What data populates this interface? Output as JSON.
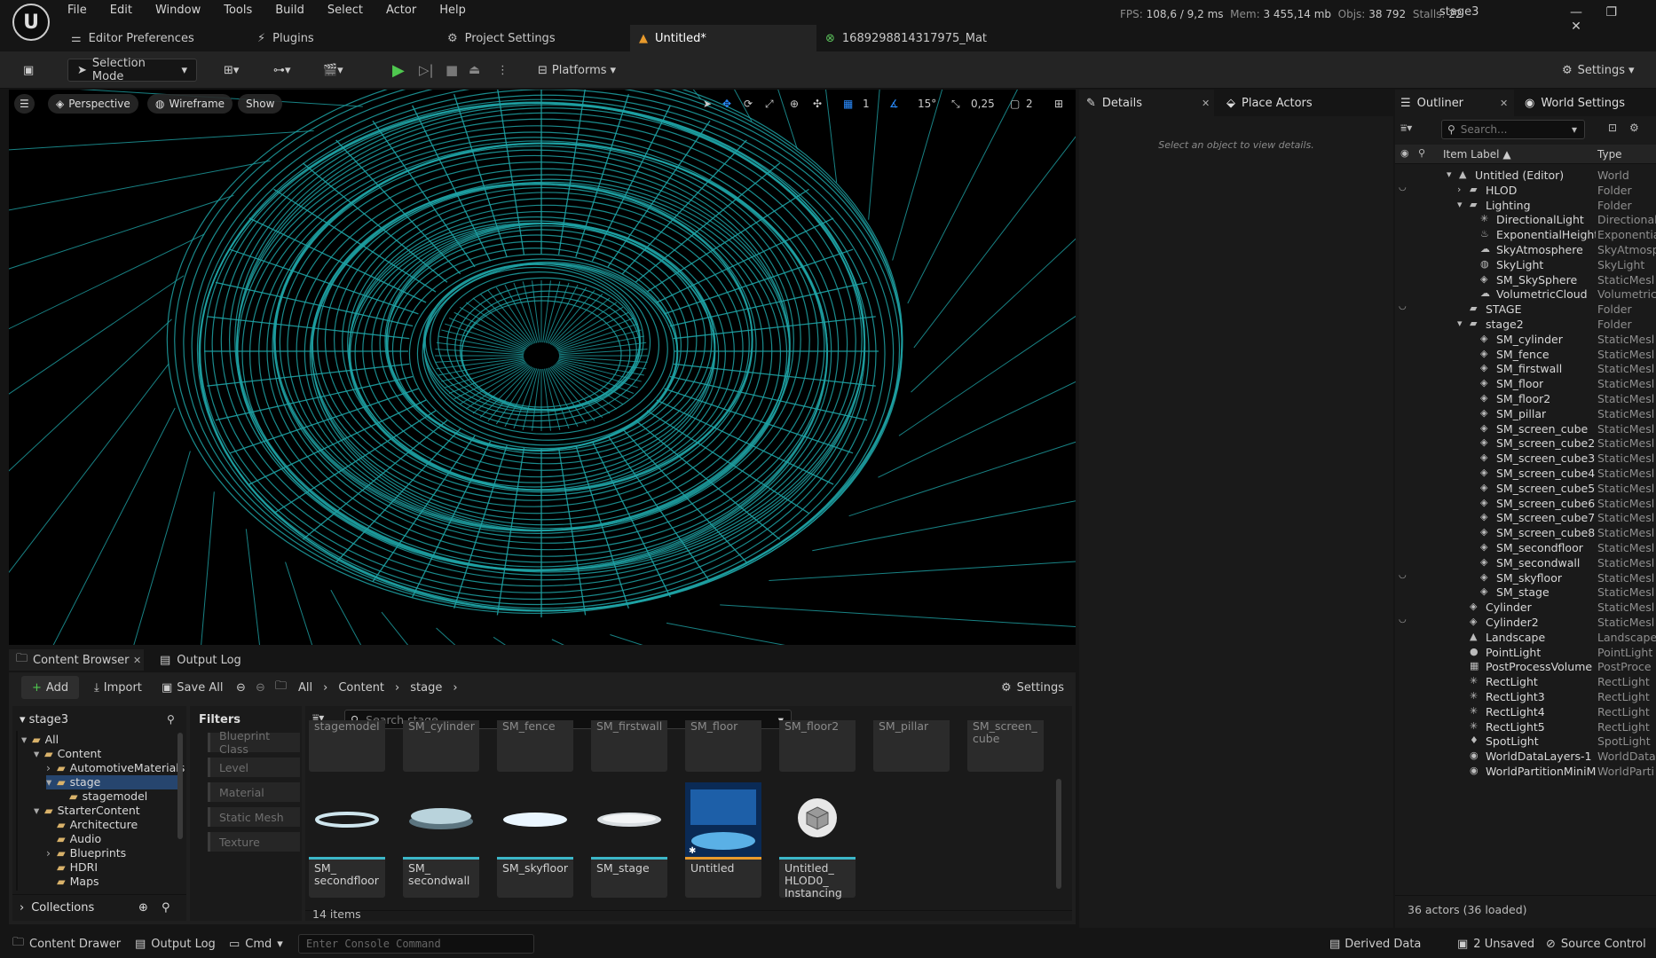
{
  "title_bar": {
    "menu": [
      "File",
      "Edit",
      "Window",
      "Tools",
      "Build",
      "Select",
      "Actor",
      "Help"
    ],
    "stats": {
      "fps_label": "FPS:",
      "fps": "108,6 / 9,2 ms",
      "mem_label": "Mem:",
      "mem": "3 455,14 mb",
      "objs_label": "Objs:",
      "objs": "38 792",
      "stalls_label": "Stalls:",
      "stalls": "22"
    },
    "project_name": "stage3"
  },
  "doc_tabs": {
    "editor_prefs": "Editor Preferences",
    "plugins": "Plugins",
    "project_settings": "Project Settings",
    "untitled": "Untitled*",
    "material": "1689298814317975_Mat"
  },
  "toolbar": {
    "selection_mode": "Selection Mode",
    "platforms": "Platforms",
    "settings": "Settings"
  },
  "viewport": {
    "perspective": "Perspective",
    "wireframe": "Wireframe",
    "show": "Show",
    "grid_value": "1",
    "angle_value": "15°",
    "scale_value": "0,25",
    "camera_speed": "2",
    "wire_color": "#1fa3a6"
  },
  "details": {
    "tab": "Details",
    "place_actors": "Place Actors",
    "empty_message": "Select an object to view details."
  },
  "outliner": {
    "tab": "Outliner",
    "world_settings": "World Settings",
    "search_placeholder": "Search...",
    "col_label": "Item Label ▲",
    "col_type": "Type",
    "rows": [
      {
        "label": "Untitled (Editor)",
        "type": "World"
      },
      {
        "label": "HLOD",
        "type": "Folder"
      },
      {
        "label": "Lighting",
        "type": "Folder"
      },
      {
        "label": "DirectionalLight",
        "type": "Directional"
      },
      {
        "label": "ExponentialHeightI",
        "type": "Exponentia"
      },
      {
        "label": "SkyAtmosphere",
        "type": "SkyAtmosp"
      },
      {
        "label": "SkyLight",
        "type": "SkyLight"
      },
      {
        "label": "SM_SkySphere",
        "type": "StaticMesl"
      },
      {
        "label": "VolumetricCloud",
        "type": "Volumetric"
      },
      {
        "label": "STAGE",
        "type": "Folder"
      },
      {
        "label": "stage2",
        "type": "Folder"
      },
      {
        "label": "SM_cylinder",
        "type": "StaticMesl"
      },
      {
        "label": "SM_fence",
        "type": "StaticMesl"
      },
      {
        "label": "SM_firstwall",
        "type": "StaticMesl"
      },
      {
        "label": "SM_floor",
        "type": "StaticMesl"
      },
      {
        "label": "SM_floor2",
        "type": "StaticMesl"
      },
      {
        "label": "SM_pillar",
        "type": "StaticMesl"
      },
      {
        "label": "SM_screen_cube",
        "type": "StaticMesl"
      },
      {
        "label": "SM_screen_cube2",
        "type": "StaticMesl"
      },
      {
        "label": "SM_screen_cube3",
        "type": "StaticMesl"
      },
      {
        "label": "SM_screen_cube4",
        "type": "StaticMesl"
      },
      {
        "label": "SM_screen_cube5",
        "type": "StaticMesl"
      },
      {
        "label": "SM_screen_cube6",
        "type": "StaticMesl"
      },
      {
        "label": "SM_screen_cube7",
        "type": "StaticMesl"
      },
      {
        "label": "SM_screen_cube8",
        "type": "StaticMesl"
      },
      {
        "label": "SM_secondfloor",
        "type": "StaticMesl"
      },
      {
        "label": "SM_secondwall",
        "type": "StaticMesl"
      },
      {
        "label": "SM_skyfloor",
        "type": "StaticMesl"
      },
      {
        "label": "SM_stage",
        "type": "StaticMesl"
      },
      {
        "label": "Cylinder",
        "type": "StaticMesl"
      },
      {
        "label": "Cylinder2",
        "type": "StaticMesl"
      },
      {
        "label": "Landscape",
        "type": "Landscape"
      },
      {
        "label": "PointLight",
        "type": "PointLight"
      },
      {
        "label": "PostProcessVolume",
        "type": "PostProce"
      },
      {
        "label": "RectLight",
        "type": "RectLight"
      },
      {
        "label": "RectLight3",
        "type": "RectLight"
      },
      {
        "label": "RectLight4",
        "type": "RectLight"
      },
      {
        "label": "RectLight5",
        "type": "RectLight"
      },
      {
        "label": "SpotLight",
        "type": "SpotLight"
      },
      {
        "label": "WorldDataLayers-1",
        "type": "WorldData"
      },
      {
        "label": "WorldPartitionMiniM",
        "type": "WorldParti"
      }
    ],
    "footer": "36 actors (36 loaded)"
  },
  "content_browser": {
    "tab": "Content Browser",
    "output_log_tab": "Output Log",
    "add": "Add",
    "import": "Import",
    "save_all": "Save All",
    "path": [
      "All",
      "Content",
      "stage"
    ],
    "settings": "Settings",
    "root": "stage3",
    "tree": [
      "All",
      "Content",
      "AutomotiveMaterials",
      "stage",
      "stagemodel",
      "StarterContent",
      "Architecture",
      "Audio",
      "Blueprints",
      "HDRI",
      "Maps"
    ],
    "collections": "Collections",
    "filters_title": "Filters",
    "filters": [
      "Blueprint Class",
      "Level",
      "Material",
      "Static Mesh",
      "Texture"
    ],
    "search_placeholder": "Search stage",
    "top_row": [
      "stagemodel",
      "SM_cylinder",
      "SM_fence",
      "SM_firstwall",
      "SM_floor",
      "SM_floor2",
      "SM_pillar",
      "SM_screen_\ncube"
    ],
    "assets": [
      "SM_\nsecondfloor",
      "SM_\nsecondwall",
      "SM_skyfloor",
      "SM_stage",
      "Untitled",
      "Untitled_\nHLOD0_\nInstancing"
    ],
    "count": "14 items"
  },
  "status_bar": {
    "content_drawer": "Content Drawer",
    "output_log": "Output Log",
    "cmd": "Cmd",
    "console_placeholder": "Enter Console Command",
    "derived_data": "Derived Data",
    "unsaved": "2 Unsaved",
    "source_control": "Source Control"
  }
}
